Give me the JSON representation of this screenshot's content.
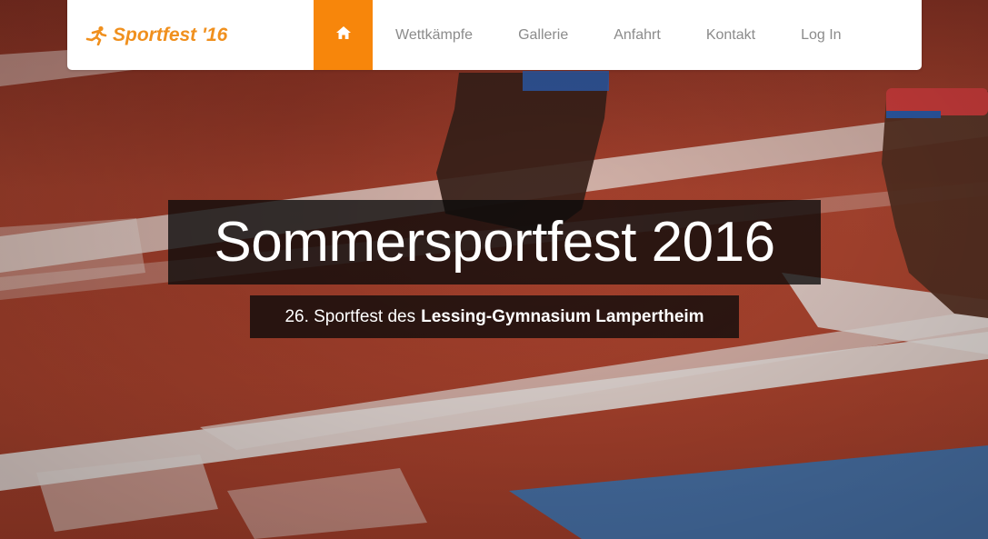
{
  "brand": {
    "text": "Sportfest '16",
    "logo_icon": "runner-icon",
    "color": "#f0901e"
  },
  "nav": {
    "home_icon": "home-icon",
    "home_bg": "#f7860b",
    "items": [
      {
        "label": "Wettkämpfe"
      },
      {
        "label": "Gallerie"
      },
      {
        "label": "Anfahrt"
      },
      {
        "label": "Kontakt"
      },
      {
        "label": "Log In"
      }
    ]
  },
  "hero": {
    "title": "Sommersportfest 2016",
    "subtitle_prefix": "26. Sportfest des",
    "subtitle_strong": "Lessing-Gymnasium Lampertheim"
  }
}
